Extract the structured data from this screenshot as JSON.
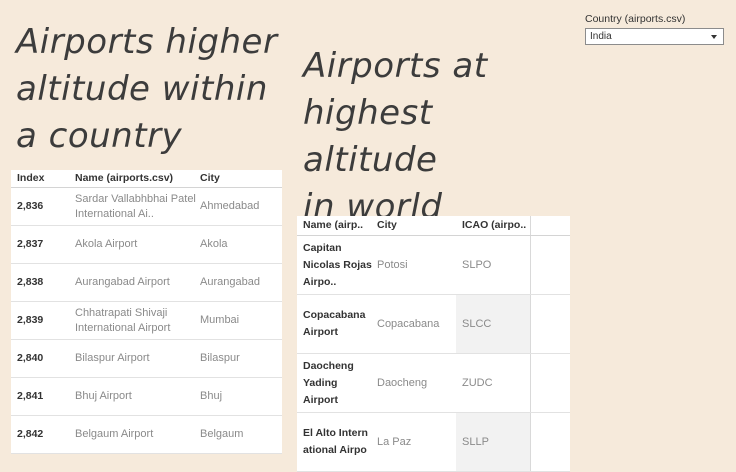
{
  "titles": {
    "left": "Airports higher\naltitude within\na country",
    "right": "Airports  at\nhighest altitude\nin world"
  },
  "filter": {
    "label": "Country (airports.csv)",
    "value": "India"
  },
  "table_country": {
    "headers": {
      "index": "Index",
      "name": "Name (airports.csv)",
      "city": "City"
    },
    "rows": [
      {
        "index": "2,836",
        "name": "Sardar Vallabhbhai Patel International Ai..",
        "city": "Ahmedabad"
      },
      {
        "index": "2,837",
        "name": "Akola Airport",
        "city": "Akola"
      },
      {
        "index": "2,838",
        "name": "Aurangabad Airport",
        "city": "Aurangabad"
      },
      {
        "index": "2,839",
        "name": "Chhatrapati Shivaji International Airport",
        "city": "Mumbai"
      },
      {
        "index": "2,840",
        "name": "Bilaspur Airport",
        "city": "Bilaspur"
      },
      {
        "index": "2,841",
        "name": "Bhuj Airport",
        "city": "Bhuj"
      },
      {
        "index": "2,842",
        "name": "Belgaum Airport",
        "city": "Belgaum"
      }
    ]
  },
  "table_world": {
    "headers": {
      "name": "Name (airp..",
      "city": "City",
      "icao": "ICAO (airpo.."
    },
    "rows": [
      {
        "name": "Capitan Nicolas Rojas Airpo..",
        "city": "Potosi",
        "icao": "SLPO"
      },
      {
        "name": "Copacabana Airport",
        "city": "Copacabana",
        "icao": "SLCC"
      },
      {
        "name": "Daocheng Yading Airport",
        "city": "Daocheng",
        "icao": "ZUDC"
      },
      {
        "name": "El Alto Intern ational Airpo",
        "city": "La Paz",
        "icao": "SLLP"
      }
    ]
  }
}
